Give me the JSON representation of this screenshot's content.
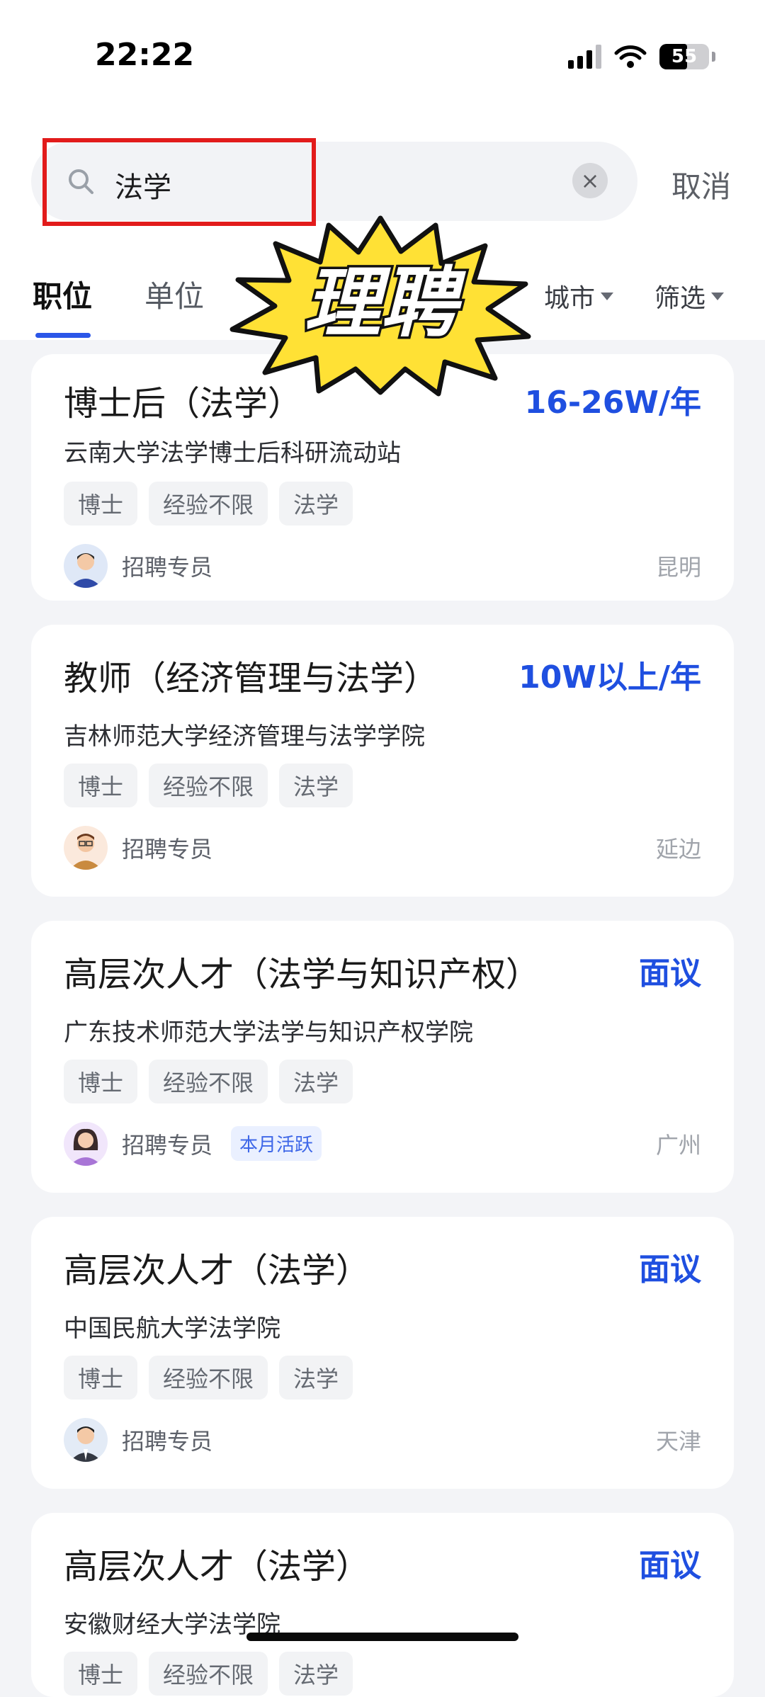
{
  "status_bar": {
    "time": "22:22",
    "battery": "55",
    "battery_level": 0.55,
    "icons": [
      "cellular-signal-icon",
      "wifi-icon",
      "battery-icon"
    ]
  },
  "search": {
    "value": "法学",
    "clear_symbol": "×",
    "cancel_label": "取消"
  },
  "tabs": [
    {
      "label": "职位",
      "active": true
    },
    {
      "label": "单位",
      "active": false
    }
  ],
  "filters": {
    "city_label": "城市",
    "filter_label": "筛选"
  },
  "sticker": {
    "text": "理聘"
  },
  "jobs": [
    {
      "title": "博士后（法学）",
      "salary": "16-26W/年",
      "org": "云南大学法学博士后科研流动站",
      "tags": [
        "博士",
        "经验不限",
        "法学"
      ],
      "recruiter": "招聘专员",
      "badge": "",
      "city": "昆明"
    },
    {
      "title": "教师（经济管理与法学）",
      "salary": "10W以上/年",
      "org": "吉林师范大学经济管理与法学学院",
      "tags": [
        "博士",
        "经验不限",
        "法学"
      ],
      "recruiter": "招聘专员",
      "badge": "",
      "city": "延边"
    },
    {
      "title": "高层次人才（法学与知识产权）",
      "salary": "面议",
      "org": "广东技术师范大学法学与知识产权学院",
      "tags": [
        "博士",
        "经验不限",
        "法学"
      ],
      "recruiter": "招聘专员",
      "badge": "本月活跃",
      "city": "广州"
    },
    {
      "title": "高层次人才（法学）",
      "salary": "面议",
      "org": "中国民航大学法学院",
      "tags": [
        "博士",
        "经验不限",
        "法学"
      ],
      "recruiter": "招聘专员",
      "badge": "",
      "city": "天津"
    },
    {
      "title": "高层次人才（法学）",
      "salary": "面议",
      "org": "安徽财经大学法学院",
      "tags": [
        "博士",
        "经验不限",
        "法学"
      ],
      "recruiter": "",
      "badge": "",
      "city": ""
    }
  ],
  "colors": {
    "accent": "#2b56e8",
    "salary": "#1f4fe0",
    "highlight": "#e21b1b",
    "sticker_fill": "#ffe135"
  }
}
